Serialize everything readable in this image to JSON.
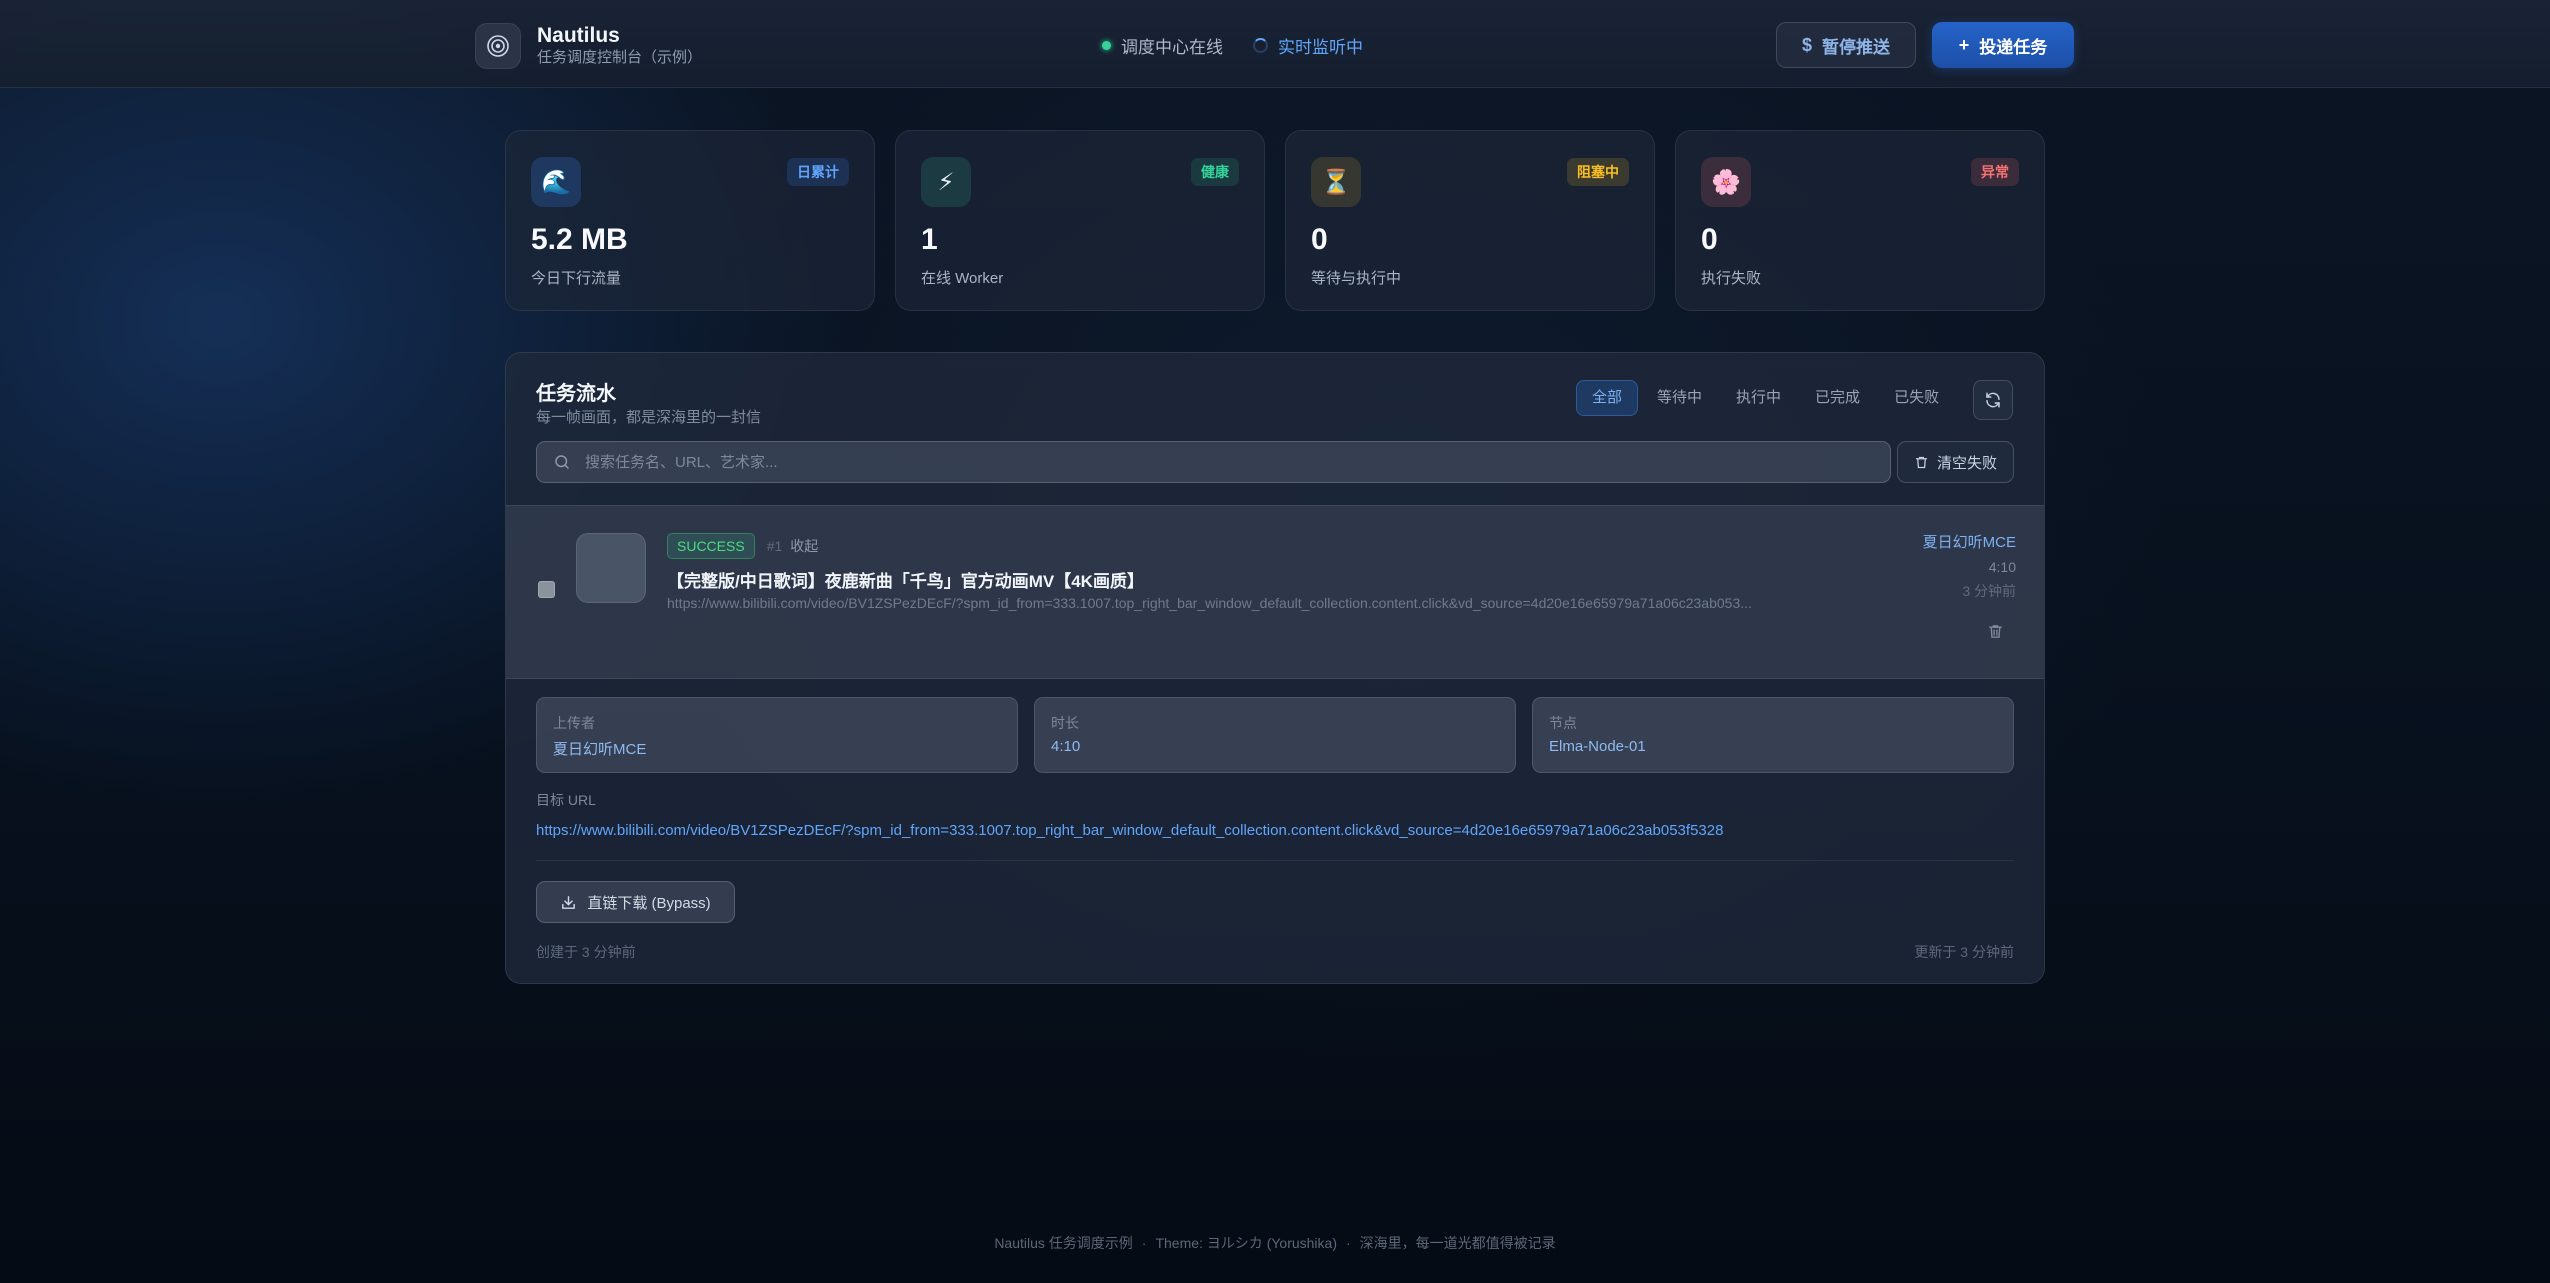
{
  "header": {
    "app_name": "Nautilus",
    "app_subtitle": "任务调度控制台（示例）",
    "icon": "sonar-icon",
    "status_online": "调度中心在线",
    "status_live": "实时监听中",
    "pause_button": "暂停推送",
    "dispatch_button": "投递任务"
  },
  "stats": [
    {
      "icon": "wave-icon",
      "emoji": "🌊",
      "badge": "日累计",
      "value": "5.2 MB",
      "label": "今日下行流量",
      "color": "#60a5fa"
    },
    {
      "icon": "lightning-icon",
      "emoji": "⚡",
      "badge": "健康",
      "value": "1",
      "label": "在线 Worker",
      "color": "#34d399"
    },
    {
      "icon": "hourglass-icon",
      "emoji": "⏳",
      "badge": "阻塞中",
      "value": "0",
      "label": "等待与执行中",
      "color": "#fbbf24"
    },
    {
      "icon": "flower-icon",
      "emoji": "🌸",
      "badge": "异常",
      "value": "0",
      "label": "执行失败",
      "color": "#f87171"
    }
  ],
  "panel": {
    "title": "任务流水",
    "subtitle": "每一帧画面，都是深海里的一封信",
    "filters": [
      "全部",
      "等待中",
      "执行中",
      "已完成",
      "已失败"
    ],
    "active_filter": "全部",
    "search_placeholder": "搜索任务名、URL、艺术家...",
    "clear_failed": "清空失败"
  },
  "task": {
    "status": "SUCCESS",
    "id": "#1",
    "collapse": "收起",
    "title": "【完整版/中日歌词】夜鹿新曲「千鸟」官方动画MV【4K画质】",
    "url": "https://www.bilibili.com/video/BV1ZSPezDEcF/?spm_id_from=333.1007.top_right_bar_window_default_collection.content.click&vd_source=4d20e16e65979a71a06c23ab053...",
    "uploader": "夏日幻听MCE",
    "duration": "4:10",
    "time_ago": "3 分钟前"
  },
  "details": {
    "uploader_label": "上传者",
    "uploader_value": "夏日幻听MCE",
    "duration_label": "时长",
    "duration_value": "4:10",
    "node_label": "节点",
    "node_value": "Elma-Node-01",
    "target_label": "目标 URL",
    "target_url": "https://www.bilibili.com/video/BV1ZSPezDEcF/?spm_id_from=333.1007.top_right_bar_window_default_collection.content.click&vd_source=4d20e16e65979a71a06c23ab053f5328",
    "bypass_button": "直链下载 (Bypass)",
    "created": "创建于 3 分钟前",
    "updated": "更新于 3 分钟前"
  },
  "footer": {
    "part1": "Nautilus 任务调度示例",
    "part2": "Theme: ヨルシカ (Yorushika)",
    "part3": "深海里，每一道光都值得被记录"
  }
}
